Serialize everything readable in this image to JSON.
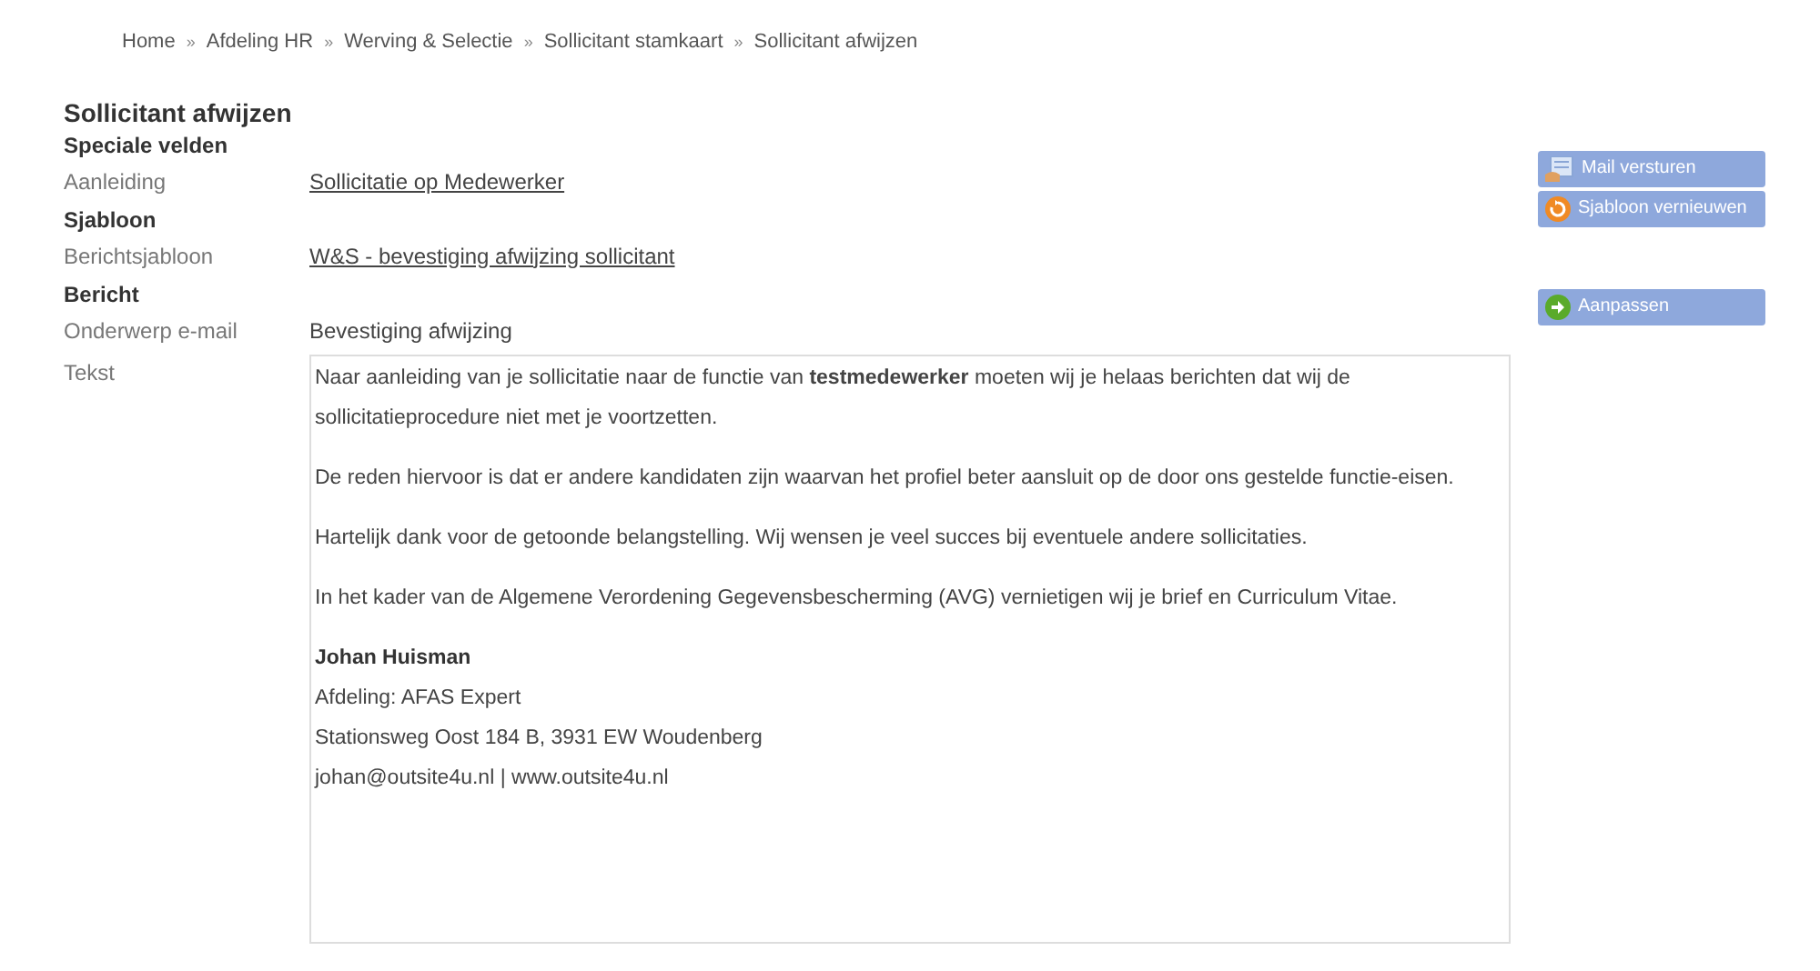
{
  "breadcrumb": {
    "separator": "»",
    "items": [
      "Home",
      "Afdeling HR",
      "Werving & Selectie",
      "Sollicitant stamkaart",
      "Sollicitant afwijzen"
    ]
  },
  "title": "Sollicitant afwijzen",
  "rows": [
    {
      "kind": "heading",
      "label": "Speciale velden"
    },
    {
      "kind": "field",
      "label": "Aanleiding",
      "value": "Sollicitatie op Medewerker",
      "link": true
    },
    {
      "kind": "heading",
      "label": "Sjabloon"
    },
    {
      "kind": "field",
      "label": "Berichtsjabloon",
      "value": "W&S - bevestiging afwijzing sollicitant",
      "link": true
    },
    {
      "kind": "heading",
      "label": "Bericht"
    },
    {
      "kind": "field",
      "label": "Onderwerp e-mail",
      "value": "Bevestiging afwijzing",
      "link": false
    }
  ],
  "message": {
    "label": "Tekst",
    "paragraphs": [
      "Naar aanleiding van je sollicitatie naar de functie van **testmedewerker** moeten wij je helaas berichten dat wij de sollicitatieprocedure niet met je voortzetten.",
      "De reden hiervoor is dat er andere kandidaten zijn waarvan het profiel beter aansluit op de door ons gestelde functie-eisen.",
      "Hartelijk dank voor de getoonde belangstelling. Wij wensen je veel succes bij eventuele andere sollicitaties.",
      "In het kader van de Algemene Verordening Gegevensbescherming (AVG) vernietigen wij je brief en Curriculum Vitae."
    ],
    "signature": [
      {
        "kind": "name",
        "text": "Johan Huisman"
      },
      {
        "kind": "line",
        "text": "Afdeling: AFAS Expert"
      },
      {
        "kind": "line",
        "text": "Stationsweg Oost 184 B, 3931 EW Woudenberg"
      },
      {
        "kind": "line",
        "text": "johan@outsite4u.nl | www.outsite4u.nl"
      }
    ]
  },
  "actions": [
    [
      {
        "label": "Mail versturen",
        "kind": "mail"
      },
      {
        "label": "Sjabloon vernieuwen",
        "kind": "refresh"
      }
    ],
    [
      {
        "label": "Aanpassen",
        "kind": "next"
      }
    ]
  ]
}
